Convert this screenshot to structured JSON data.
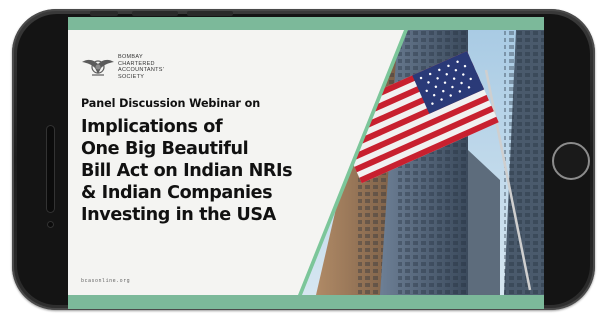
{
  "organization": {
    "name_lines": [
      "BOMBAY",
      "CHARTERED",
      "ACCOUNTANTS'",
      "SOCIETY"
    ]
  },
  "slide": {
    "subtitle": "Panel Discussion Webinar on",
    "headline_lines": [
      "Implications of",
      "One Big Beautiful",
      "Bill Act on Indian NRIs",
      "& Indian Companies",
      "Investing in the USA"
    ],
    "website": "bcasonline.org"
  },
  "colors": {
    "accent_green": "#7cb99a",
    "text_dark": "#111111",
    "slide_background": "#f4f4f2",
    "phone_frame": "#1c1c1c"
  }
}
